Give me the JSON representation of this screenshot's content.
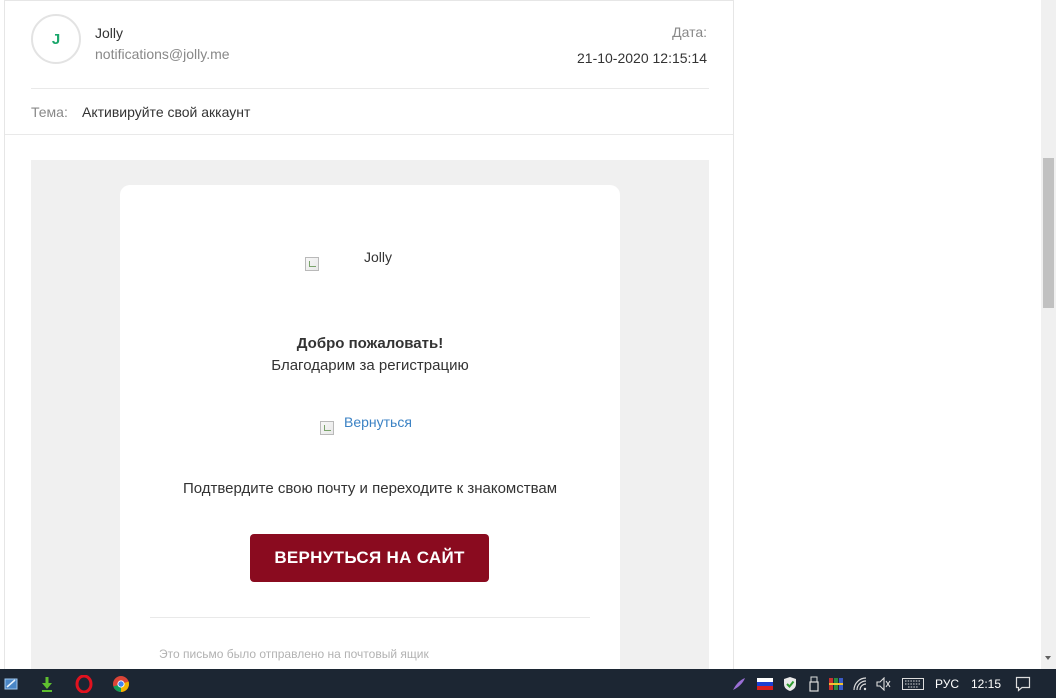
{
  "email": {
    "avatar_letter": "J",
    "sender_name": "Jolly",
    "sender_email": "notifications@jolly.me",
    "date_label": "Дата:",
    "date_value": "21-10-2020 12:15:14",
    "subject_label": "Тема:",
    "subject_value": "Активируйте свой аккаунт"
  },
  "email_body": {
    "logo_alt": "Jolly",
    "welcome_title": "Добро пожаловать!",
    "welcome_subtitle": "Благодарим за регистрацию",
    "image2_alt": "Вернуться",
    "confirm_text": "Подтвердите свою почту и переходите к знакомствам",
    "cta_label": "ВЕРНУТЬСЯ НА САЙТ",
    "footer_text": "Это письмо было отправлено на почтовый ящик"
  },
  "taskbar": {
    "language": "РУС",
    "time": "12:15"
  },
  "colors": {
    "accent_green": "#1aa66b",
    "cta_background": "#8a0b1f",
    "taskbar_background": "#1c2633"
  }
}
